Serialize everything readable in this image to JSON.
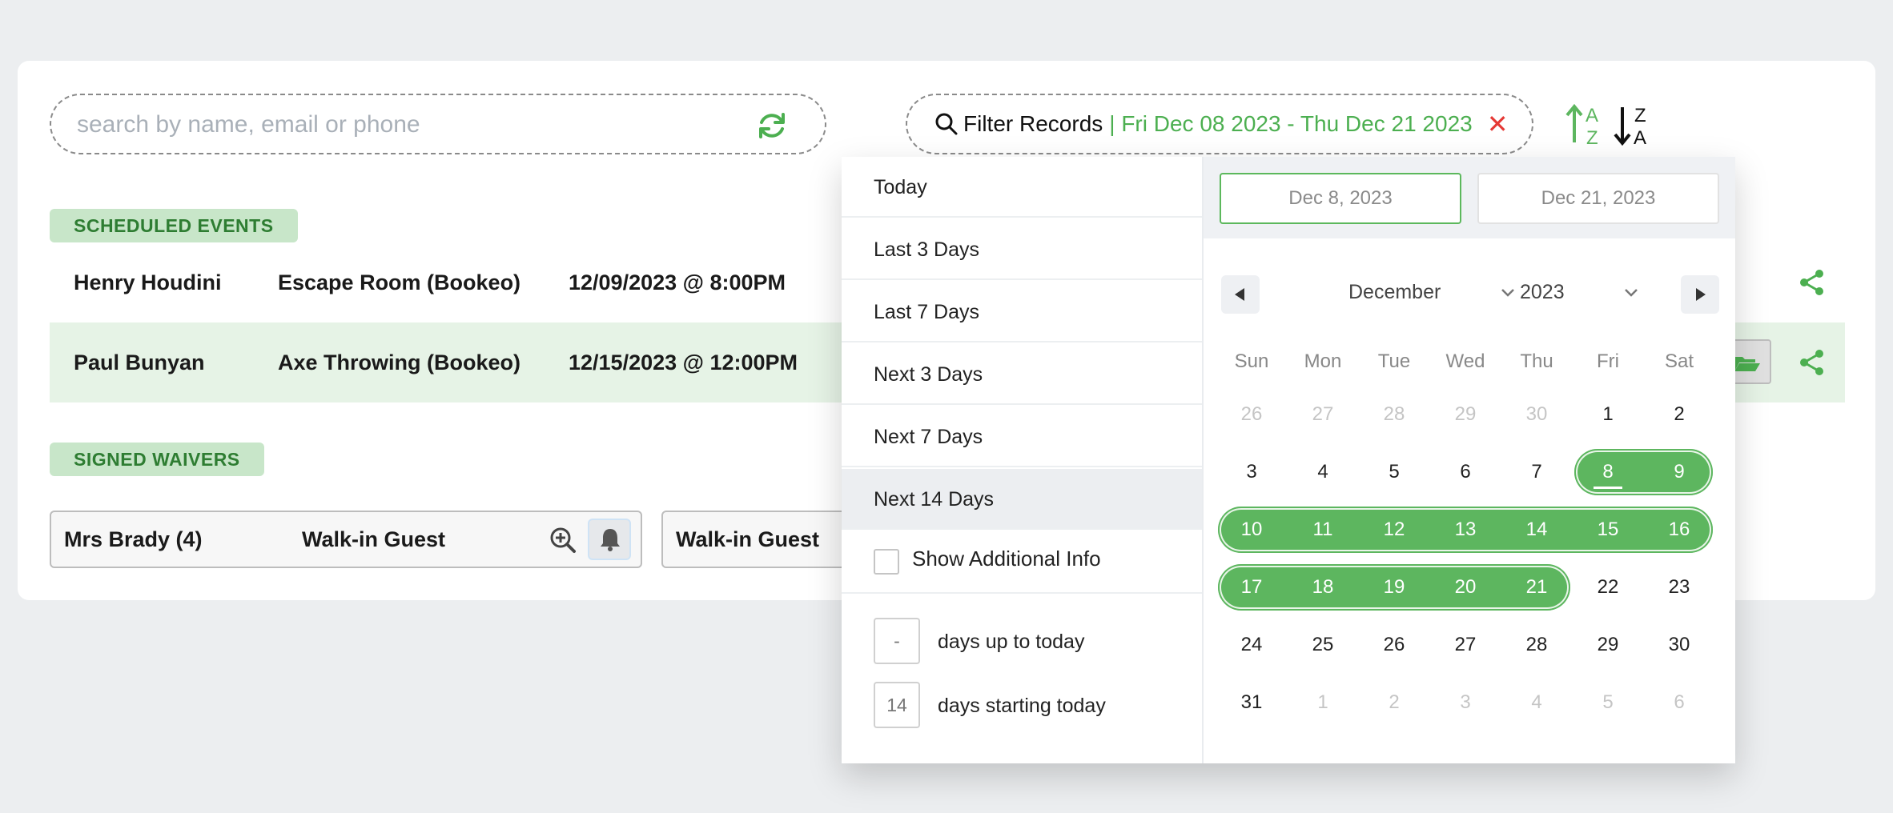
{
  "search": {
    "placeholder": "search by name, email or phone"
  },
  "filter": {
    "label": "Filter Records",
    "range": "| Fri Dec 08 2023 - Thu Dec 21 2023",
    "clear": "✕"
  },
  "sections": {
    "scheduled": "SCHEDULED EVENTS",
    "waivers": "SIGNED WAIVERS"
  },
  "events": [
    {
      "name": "Henry Houdini",
      "activity": "Escape Room (Bookeo)",
      "datetime": "12/09/2023 @ 8:00PM"
    },
    {
      "name": "Paul Bunyan",
      "activity": "Axe Throwing (Bookeo)",
      "datetime": "12/15/2023 @ 12:00PM"
    }
  ],
  "waivers": [
    {
      "name": "Mrs Brady (4)",
      "type": "Walk-in Guest"
    },
    {
      "name": "",
      "type": "Walk-in Guest"
    }
  ],
  "presets": [
    "Today",
    "Last 3 Days",
    "Last 7 Days",
    "Next 3 Days",
    "Next 7 Days",
    "Next 14 Days"
  ],
  "active_preset": "Next 14 Days",
  "show_additional": {
    "label": "Show Additional Info",
    "checked": false
  },
  "days_up_to_today": {
    "value": "-",
    "label": "days up to today"
  },
  "days_starting_today": {
    "value": "14",
    "label": "days starting today"
  },
  "calendar": {
    "start": "Dec 8, 2023",
    "end": "Dec 21, 2023",
    "month": "December",
    "year": "2023",
    "weekdays": [
      "Sun",
      "Mon",
      "Tue",
      "Wed",
      "Thu",
      "Fri",
      "Sat"
    ],
    "weeks": [
      [
        "26",
        "27",
        "28",
        "29",
        "30",
        "1",
        "2"
      ],
      [
        "3",
        "4",
        "5",
        "6",
        "7",
        "8",
        "9"
      ],
      [
        "10",
        "11",
        "12",
        "13",
        "14",
        "15",
        "16"
      ],
      [
        "17",
        "18",
        "19",
        "20",
        "21",
        "22",
        "23"
      ],
      [
        "24",
        "25",
        "26",
        "27",
        "28",
        "29",
        "30"
      ],
      [
        "31",
        "1",
        "2",
        "3",
        "4",
        "5",
        "6"
      ]
    ],
    "selected_days": [
      "8",
      "9",
      "10",
      "11",
      "12",
      "13",
      "14",
      "15",
      "16",
      "17",
      "18",
      "19",
      "20",
      "21"
    ],
    "today": "8"
  },
  "colors": {
    "accent": "#5db65f",
    "accent_dark": "#2e7d32",
    "badge_bg": "#c8e6c9",
    "danger": "#e53935"
  }
}
